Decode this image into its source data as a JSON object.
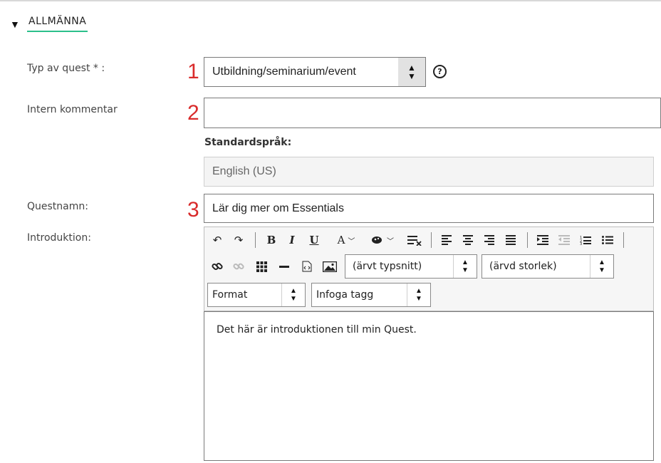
{
  "section": {
    "title": "ALLMÄNNA"
  },
  "fields": {
    "quest_type": {
      "label": "Typ av quest * :",
      "value": "Utbildning/seminarium/event",
      "marker": "1"
    },
    "internal_comment": {
      "label": "Intern kommentar",
      "value": "",
      "marker": "2"
    },
    "standard_language": {
      "label": "Standardspråk:",
      "value": "English (US)"
    },
    "quest_name": {
      "label": "Questnamn:",
      "value": "Lär dig mer om Essentials",
      "marker": "3"
    },
    "introduction": {
      "label": "Introduktion:"
    }
  },
  "help_icon": {
    "glyph": "?"
  },
  "toolbar": {
    "font_select": "(ärvt typsnitt)",
    "size_select": "(ärvd storlek)",
    "format_select": "Format",
    "tag_select": "Infoga tagg",
    "bold": "B",
    "italic": "I",
    "underline": "U",
    "text_color": "A",
    "icons": [
      "undo-icon",
      "redo-icon",
      "bold-icon",
      "italic-icon",
      "underline-icon",
      "text-color-icon",
      "bg-color-icon",
      "clear-format-icon",
      "align-left-icon",
      "align-center-icon",
      "align-right-icon",
      "align-justify-icon",
      "indent-icon",
      "outdent-icon",
      "numbered-list-icon",
      "bullet-list-icon",
      "link-icon",
      "unlink-icon",
      "table-icon",
      "horizontal-rule-icon",
      "source-icon",
      "image-icon"
    ]
  },
  "editor": {
    "content": "Det här är introduktionen till min Quest."
  },
  "colors": {
    "accent_underline": "#2bbf8a",
    "marker": "#d92b2b"
  }
}
